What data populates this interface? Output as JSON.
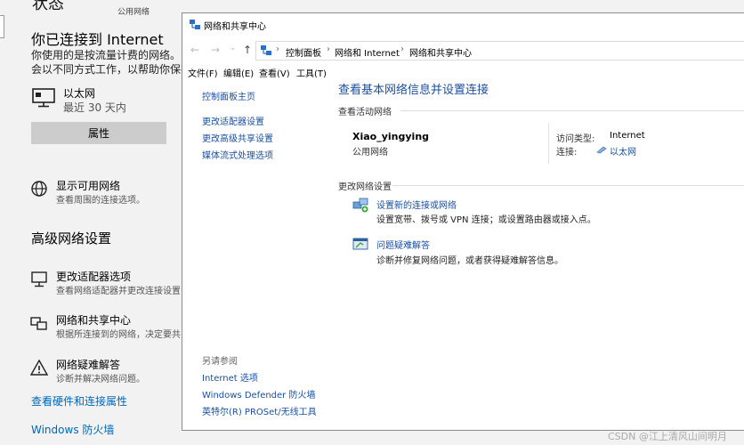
{
  "settings": {
    "top_cut_title": "状态",
    "top_small": "公用网络",
    "connected_heading": "你已连接到 Internet",
    "desc_line1": "你使用的是按流量计费的网络。",
    "desc_line2": "会以不同方式工作，以帮助你保存",
    "ethernet": {
      "name": "以太网",
      "sub": "最近 30 天内",
      "icon": "ethernet-pc-icon"
    },
    "properties_button": "属性",
    "show_networks": {
      "title": "显示可用网络",
      "sub": "查看周围的连接选项。",
      "icon": "globe-icon"
    },
    "advanced_heading": "高级网络设置",
    "adv_items": [
      {
        "title": "更改适配器选项",
        "sub": "查看网络适配器并更改连接设置",
        "icon": "adapter-icon"
      },
      {
        "title": "网络和共享中心",
        "sub": "根据所连接到的网络，决定要共",
        "icon": "sharing-center-icon"
      },
      {
        "title": "网络疑难解答",
        "sub": "诊断并解决网络问题。",
        "icon": "warning-icon"
      }
    ],
    "links": [
      "查看硬件和连接属性",
      "Windows 防火墙"
    ]
  },
  "window": {
    "title": "网络和共享中心",
    "breadcrumb": [
      "控制面板",
      "网络和 Internet",
      "网络和共享中心"
    ],
    "nav": {
      "back": "←",
      "forward": "→",
      "dropdown": "⌄",
      "up": "↑"
    },
    "menu": [
      "文件(F)",
      "编辑(E)",
      "查看(V)",
      "工具(T)"
    ],
    "sidebar": {
      "home": "控制面板主页",
      "links": [
        "更改适配器设置",
        "更改高级共享设置",
        "媒体流式处理选项"
      ],
      "see_also_label": "另请参阅",
      "see_also": [
        "Internet 选项",
        "Windows Defender 防火墙",
        "英特尔(R) PROSet/无线工具"
      ]
    },
    "main": {
      "title": "查看基本网络信息并设置连接",
      "active_label": "查看活动网络",
      "network_name": "Xiao_yingying",
      "network_type": "公用网络",
      "access_type_label": "访问类型:",
      "access_type_value": "Internet",
      "connection_label": "连接:",
      "connection_value": "以太网",
      "change_label": "更改网络设置",
      "tasks": [
        {
          "title": "设置新的连接或网络",
          "sub": "设置宽带、拨号或 VPN 连接；或设置路由器或接入点。",
          "icon": "new-connection-icon"
        },
        {
          "title": "问题疑难解答",
          "sub": "诊断并修复网络问题，或者获得疑难解答信息。",
          "icon": "troubleshoot-icon"
        }
      ]
    }
  },
  "watermark": "CSDN @江上清风山间明月"
}
